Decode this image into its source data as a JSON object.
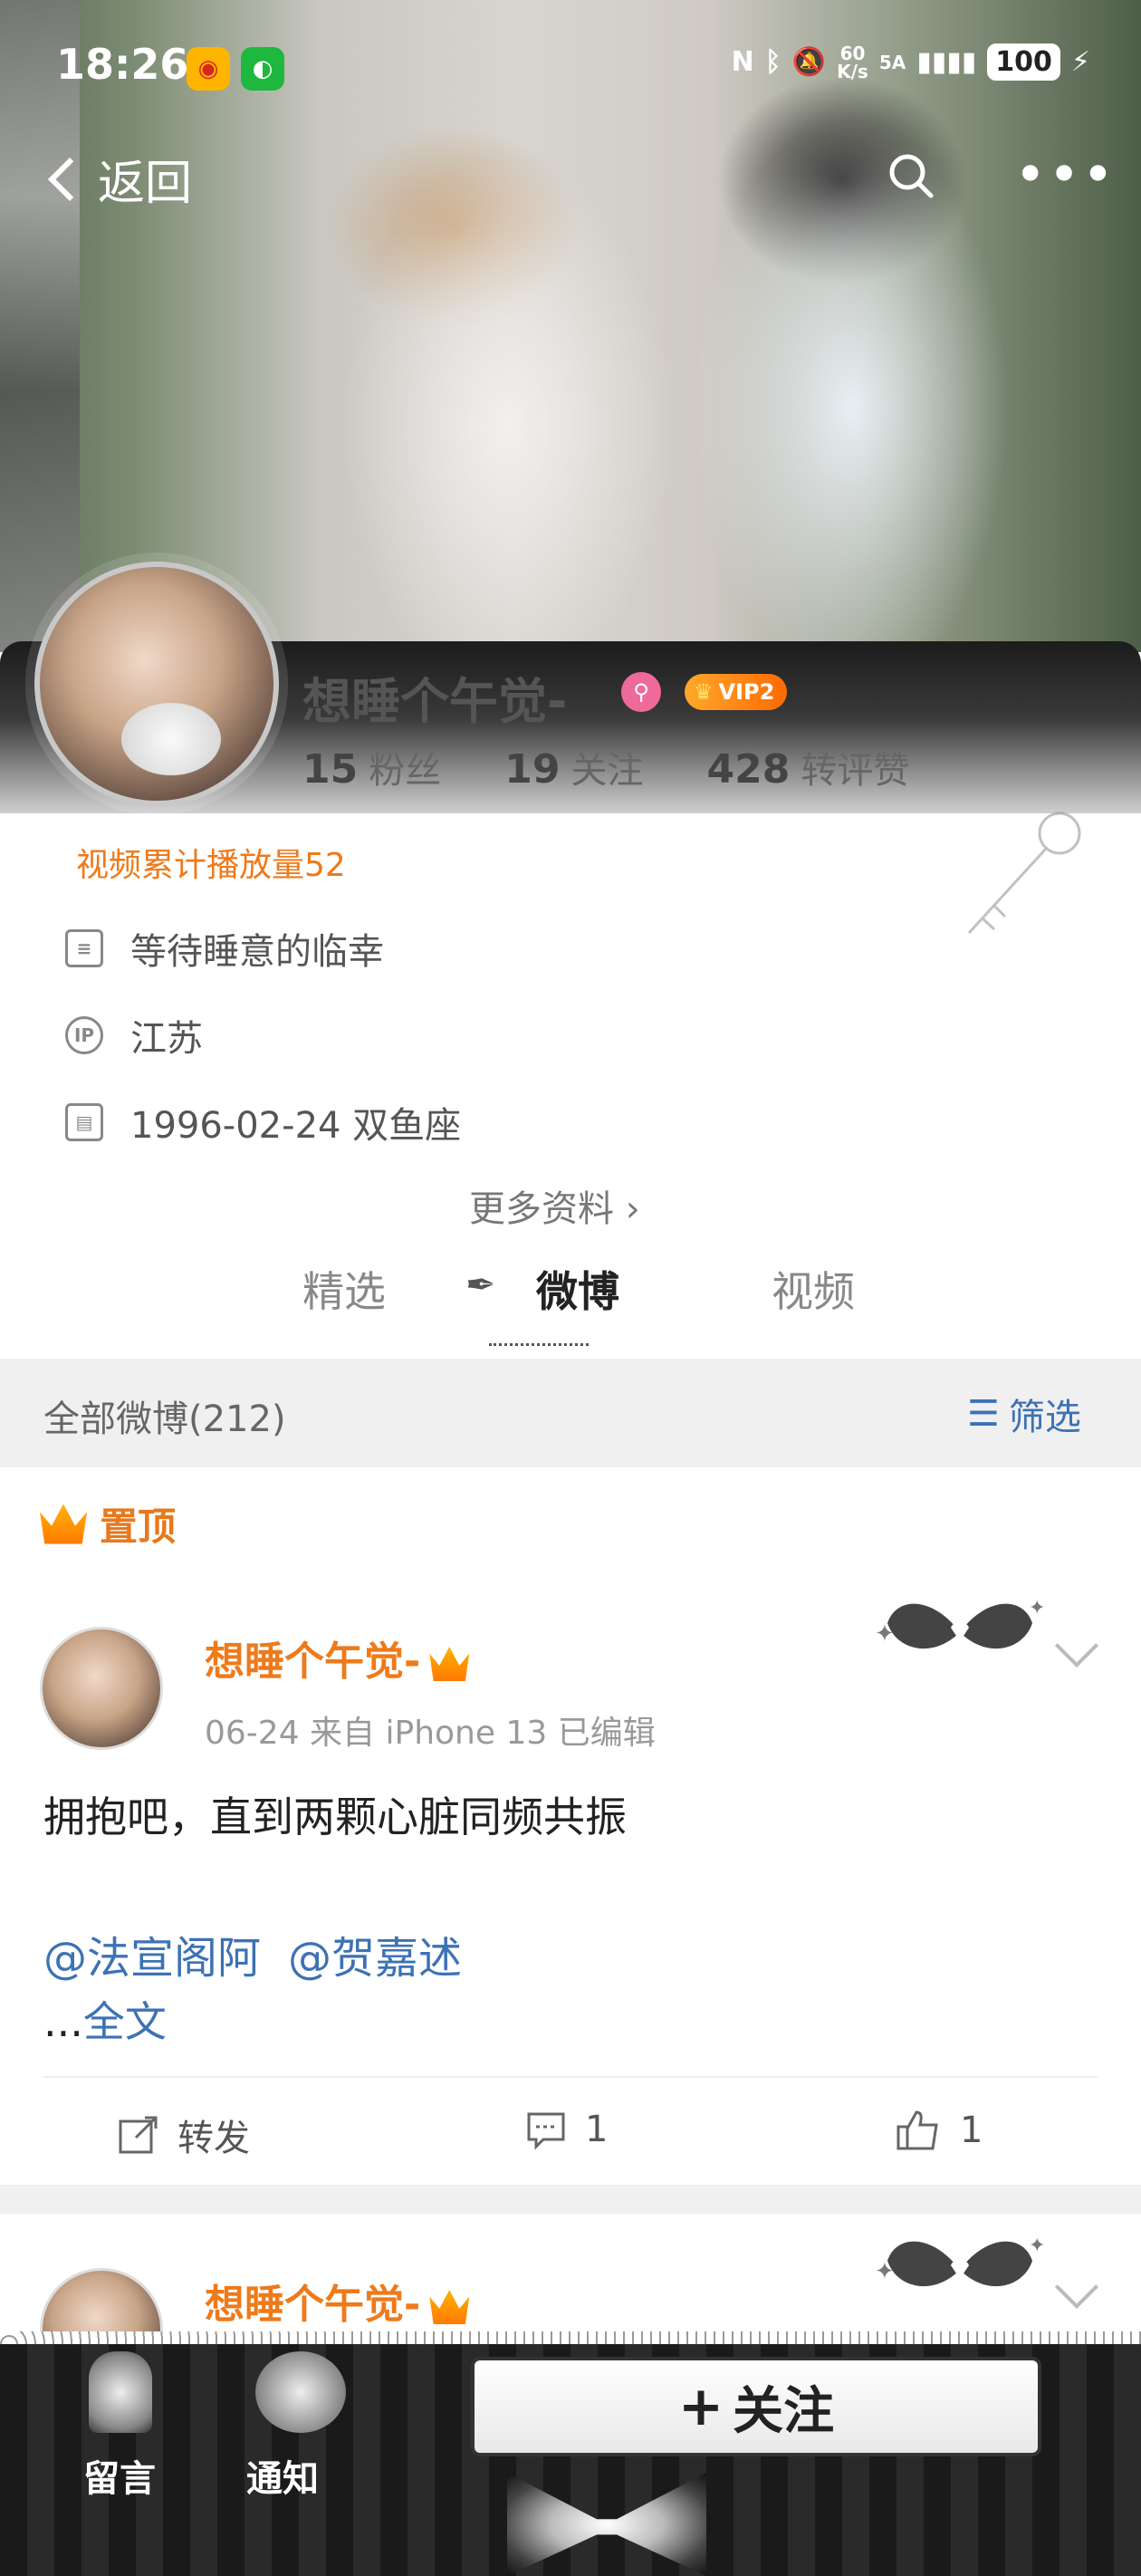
{
  "status_bar": {
    "time": "18:26",
    "network_speed_top": "60",
    "network_speed_unit": "K/s",
    "network_label": "5A",
    "battery": "100"
  },
  "nav": {
    "back_label": "返回"
  },
  "profile": {
    "name": "想睡个午觉-",
    "vip_label": "VIP2",
    "followers_count": "15",
    "followers_label": "粉丝",
    "following_count": "19",
    "following_label": "关注",
    "likes_count": "428",
    "likes_label": "转评赞",
    "video_plays": "视频累计播放量52",
    "bio": "等待睡意的临幸",
    "ip_icon_label": "IP",
    "location": "江苏",
    "birthday": "1996-02-24 双鱼座",
    "more_info": "更多资料 ›"
  },
  "tabs": [
    {
      "label": "精选"
    },
    {
      "label": "微博"
    },
    {
      "label": "视频"
    }
  ],
  "list": {
    "count_label": "全部微博(212)",
    "filter_label": "筛选"
  },
  "pinned_label": "置顶",
  "posts": [
    {
      "author": "想睡个午觉-",
      "meta": "06-24  来自 iPhone 13  已编辑",
      "text": "拥抱吧，直到两颗心脏同频共振",
      "mentions": [
        "@法宣阁阿",
        "@贺嘉述"
      ],
      "full_text_prefix": "...",
      "full_text_link": "全文",
      "repost_label": "转发",
      "comment_count": "1",
      "like_count": "1"
    },
    {
      "author": "想睡个午觉-"
    }
  ],
  "bottom_bar": {
    "message_label": "留言",
    "notify_label": "通知",
    "follow_label": "关注"
  },
  "colors": {
    "accent_orange": "#ee7a1a",
    "link_blue": "#3d72b4"
  }
}
